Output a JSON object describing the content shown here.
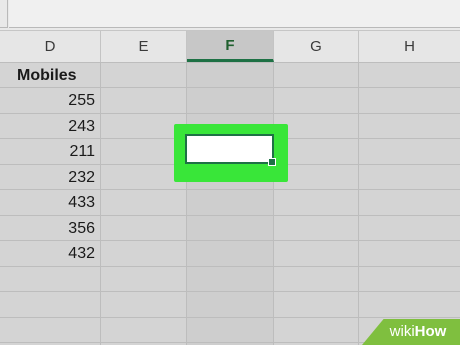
{
  "sheet": {
    "columns": [
      {
        "letter": "D"
      },
      {
        "letter": "E"
      },
      {
        "letter": "F"
      },
      {
        "letter": "G"
      },
      {
        "letter": "H"
      }
    ],
    "column_d": {
      "header": "Mobiles",
      "values": [
        "255",
        "243",
        "211",
        "232",
        "433",
        "356",
        "432"
      ]
    },
    "active_cell": {
      "column": "F",
      "value": ""
    },
    "colors": {
      "highlight": "#39e639",
      "selection_border": "#1e7145"
    }
  },
  "watermark": {
    "prefix": "wiki",
    "suffix": "How"
  }
}
